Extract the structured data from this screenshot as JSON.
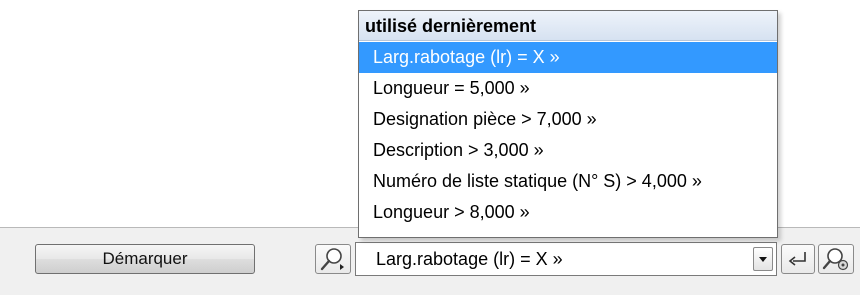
{
  "toolbar": {
    "demarquer_label": "Démarquer"
  },
  "combo": {
    "value": "Larg.rabotage (lr) = X »"
  },
  "dropdown": {
    "header": "utilisé dernièrement",
    "items": [
      {
        "label": "Larg.rabotage (lr) = X »",
        "selected": true
      },
      {
        "label": "Longueur =  5,000 »",
        "selected": false
      },
      {
        "label": "Designation pièce > 7,000 »",
        "selected": false
      },
      {
        "label": "Description > 3,000 »",
        "selected": false
      },
      {
        "label": "Numéro de liste statique (N° S) > 4,000 »",
        "selected": false
      },
      {
        "label": "Longueur >  8,000 »",
        "selected": false
      }
    ]
  },
  "icons": {
    "search_left": "search-icon",
    "combo_arrow": "chevron-down-icon",
    "apply": "enter-return-icon",
    "search_settings": "search-settings-icon"
  },
  "colors": {
    "selection": "#3399ff",
    "header_bg": "#dce6f3",
    "toolbar_bg": "#f0f0f0"
  }
}
